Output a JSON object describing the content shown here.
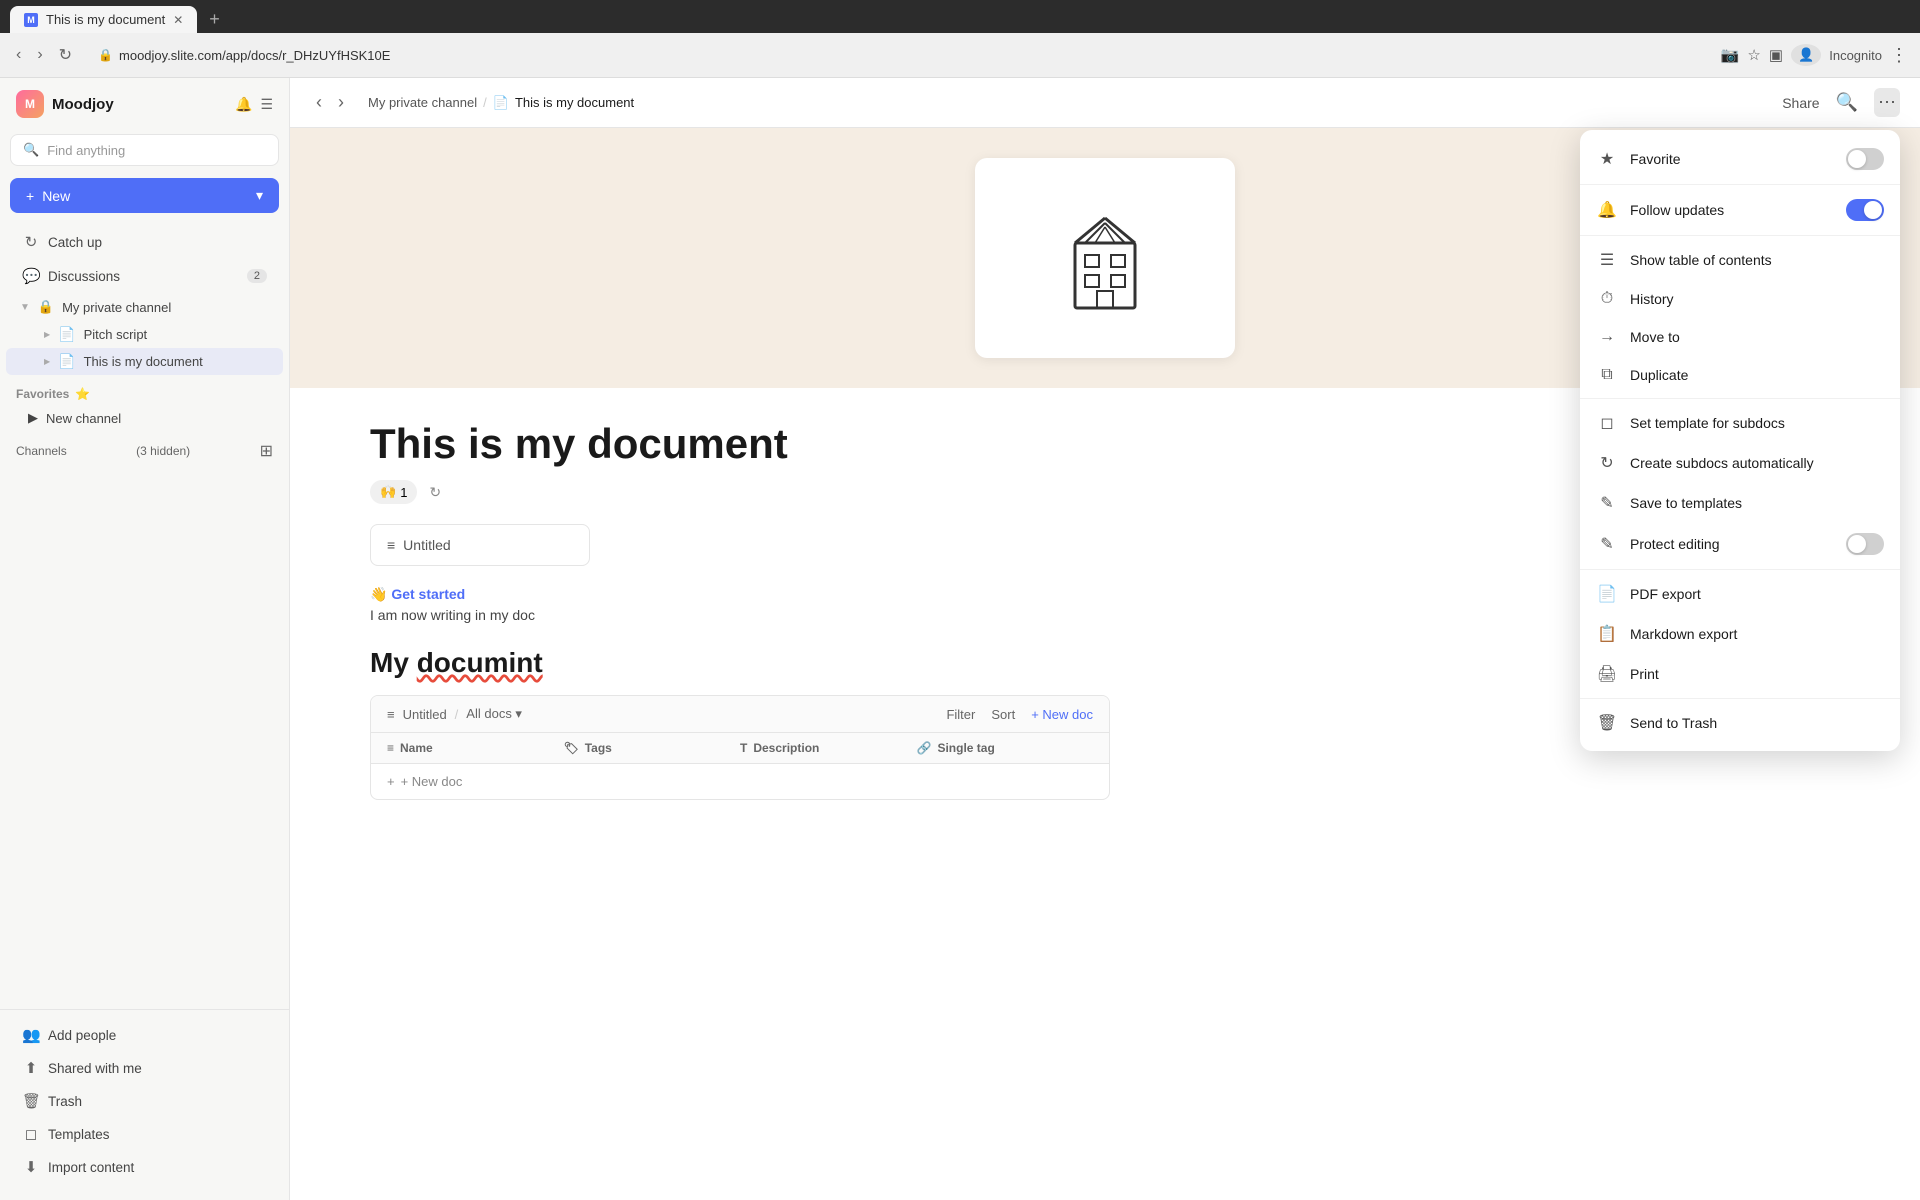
{
  "browser": {
    "url": "moodjoy.slite.com/app/docs/r_DHzUYfHSK10E",
    "tab_title": "This is my document",
    "tab_favicon": "M",
    "user_label": "Incognito"
  },
  "sidebar": {
    "workspace": "Moodjoy",
    "search_placeholder": "Find anything",
    "new_button": "New",
    "items": [
      {
        "id": "catch-up",
        "label": "Catch up",
        "icon": "↻"
      },
      {
        "id": "discussions",
        "label": "Discussions",
        "icon": "💬",
        "badge": "2"
      }
    ],
    "private_channel": {
      "label": "My private channel",
      "docs": [
        {
          "id": "pitch-script",
          "label": "Pitch script"
        },
        {
          "id": "this-is-my-document",
          "label": "This is my document",
          "active": true
        }
      ]
    },
    "favorites": {
      "label": "Favorites",
      "items": [
        {
          "id": "new-channel",
          "label": "New channel"
        }
      ]
    },
    "channels": {
      "label": "Channels",
      "sublabel": "(3 hidden)"
    },
    "bottom_items": [
      {
        "id": "add-people",
        "label": "Add people",
        "icon": "👥"
      },
      {
        "id": "shared-with-me",
        "label": "Shared with me",
        "icon": "⬆"
      },
      {
        "id": "trash",
        "label": "Trash",
        "icon": "🗑"
      },
      {
        "id": "templates",
        "label": "Templates",
        "icon": "◻"
      },
      {
        "id": "import-content",
        "label": "Import content",
        "icon": "⬇"
      }
    ]
  },
  "topbar": {
    "breadcrumb_channel": "My private channel",
    "breadcrumb_doc": "This is my document",
    "share_label": "Share"
  },
  "document": {
    "title": "This is my document",
    "reaction_emoji": "🙌",
    "reaction_count": "1",
    "card_label": "Untitled",
    "get_started_label": "👋 Get started",
    "get_started_text": "I am now writing in my doc",
    "subtitle": "My documint",
    "db_table": {
      "path": "Untitled",
      "filter_label": "All docs",
      "filter_btn": "Filter",
      "sort_btn": "Sort",
      "new_doc_btn": "+ New doc",
      "columns": [
        {
          "label": "Name",
          "icon": "≡"
        },
        {
          "label": "Tags",
          "icon": "🏷"
        },
        {
          "label": "Description",
          "icon": "T"
        },
        {
          "label": "Single tag",
          "icon": "🔗"
        }
      ],
      "add_row_label": "+ New doc"
    }
  },
  "dropdown_menu": {
    "items": [
      {
        "id": "favorite",
        "label": "Favorite",
        "icon": "★",
        "toggle": true,
        "toggle_state": "off"
      },
      {
        "id": "follow-updates",
        "label": "Follow updates",
        "icon": "🔔",
        "toggle": true,
        "toggle_state": "on"
      },
      {
        "id": "show-toc",
        "label": "Show table of contents",
        "icon": "☰",
        "toggle": false
      },
      {
        "id": "history",
        "label": "History",
        "icon": "⏱",
        "toggle": false
      },
      {
        "id": "move-to",
        "label": "Move to",
        "icon": "→",
        "toggle": false
      },
      {
        "id": "duplicate",
        "label": "Duplicate",
        "icon": "⧉",
        "toggle": false
      },
      {
        "id": "set-template",
        "label": "Set template for subdocs",
        "icon": "◻",
        "toggle": false
      },
      {
        "id": "create-subdocs",
        "label": "Create subdocs automatically",
        "icon": "↻",
        "toggle": false
      },
      {
        "id": "save-templates",
        "label": "Save to templates",
        "icon": "✎",
        "toggle": false
      },
      {
        "id": "protect-editing",
        "label": "Protect editing",
        "icon": "✎",
        "toggle": true,
        "toggle_state": "off"
      },
      {
        "id": "pdf-export",
        "label": "PDF export",
        "icon": "📄",
        "toggle": false
      },
      {
        "id": "markdown-export",
        "label": "Markdown export",
        "icon": "📋",
        "toggle": false
      },
      {
        "id": "print",
        "label": "Print",
        "icon": "🖨",
        "toggle": false
      },
      {
        "id": "send-to-trash",
        "label": "Send to Trash",
        "icon": "🗑",
        "toggle": false
      }
    ]
  }
}
